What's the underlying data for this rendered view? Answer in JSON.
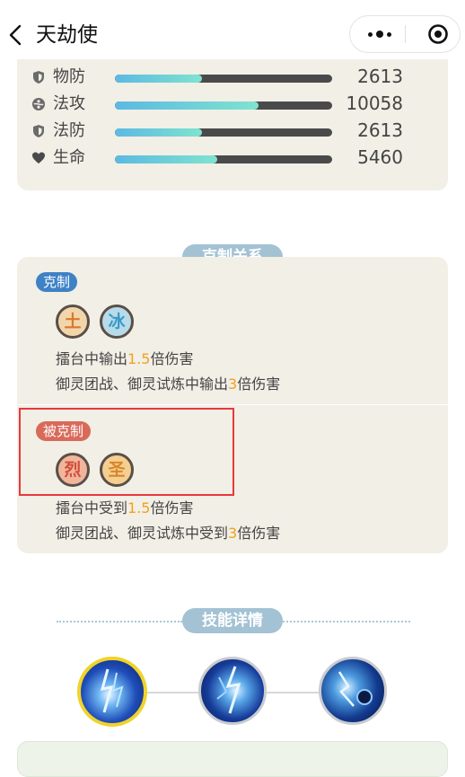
{
  "nav": {
    "title": "天劫使",
    "icons": {
      "back": "chevron-left-icon",
      "more": "more-dots-icon",
      "close": "target-close-icon"
    }
  },
  "stats": [
    {
      "label": "物防",
      "value": "2613",
      "fill": 0.4,
      "icon": "shield-icon"
    },
    {
      "label": "法攻",
      "value": "10058",
      "fill": 0.66,
      "icon": "yin-yang-icon"
    },
    {
      "label": "法防",
      "value": "2613",
      "fill": 0.4,
      "icon": "shield-icon"
    },
    {
      "label": "生命",
      "value": "5460",
      "fill": 0.47,
      "icon": "heart-icon"
    }
  ],
  "counter": {
    "title": "克制关系",
    "strong": {
      "badge": "克制",
      "elements": [
        {
          "char": "土",
          "color": "#e08a3a"
        },
        {
          "char": "冰",
          "color": "#4aa6cf"
        }
      ],
      "line1": {
        "pre": "擂台中输出",
        "num": "1.5",
        "post": "倍伤害"
      },
      "line2": {
        "pre": "御灵团战、御灵试炼中输出",
        "num": "3",
        "post": "倍伤害"
      }
    },
    "weak": {
      "badge": "被克制",
      "elements": [
        {
          "char": "烈",
          "color": "#d9594a"
        },
        {
          "char": "圣",
          "color": "#e59a36"
        }
      ],
      "line1": {
        "pre": "擂台中受到",
        "num": "1.5",
        "post": "倍伤害"
      },
      "line2": {
        "pre": "御灵团战、御灵试炼中受到",
        "num": "3",
        "post": "倍伤害"
      }
    }
  },
  "skills": {
    "title": "技能详情",
    "items": [
      {
        "name": "skill-1",
        "selected": true
      },
      {
        "name": "skill-2",
        "selected": false
      },
      {
        "name": "skill-3",
        "selected": false
      }
    ]
  },
  "colors": {
    "panel": "#f1efe6",
    "accent_orange": "#f2a21b",
    "badge_blue": "#3e82c6",
    "badge_red": "#d96a5a",
    "header_pill": "#a3c2d4",
    "highlight_red": "#e8383d"
  }
}
